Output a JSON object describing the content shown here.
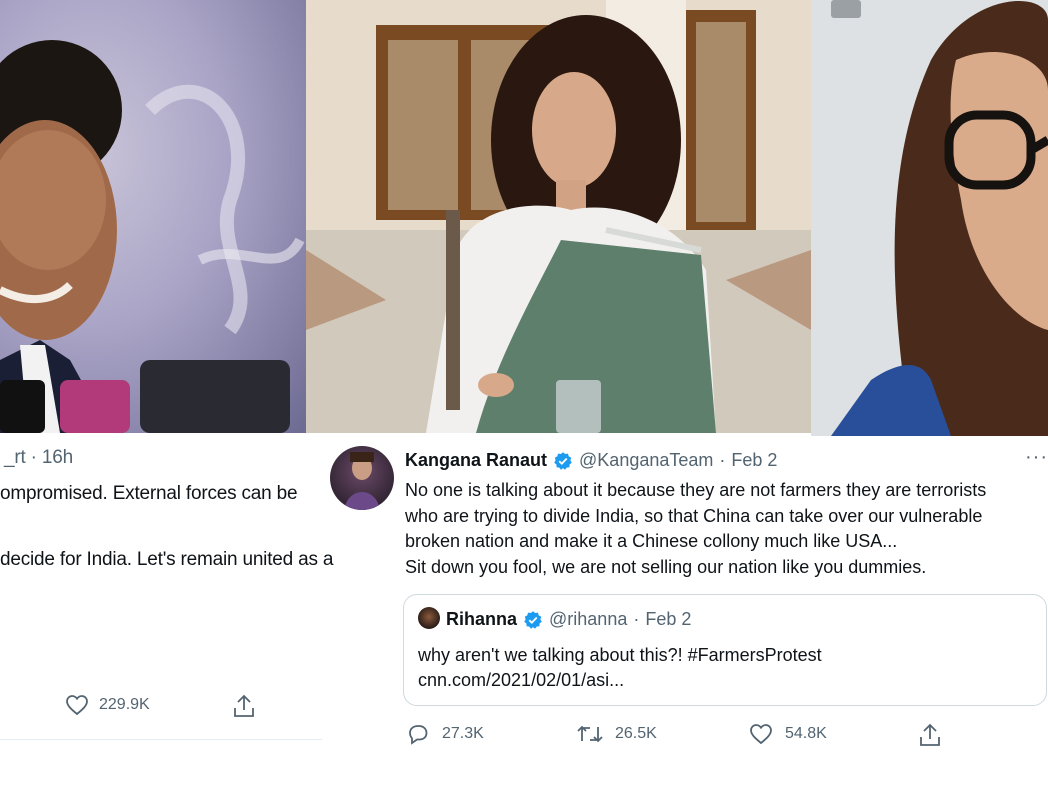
{
  "left_tweet": {
    "meta": "_rt · 16h",
    "text_line1": "ompromised. External forces can be",
    "text_line2": "decide for India. Let's remain united as a",
    "like_count": "229.9K"
  },
  "main_tweet": {
    "author_name": "Kangana Ranaut",
    "handle": "@KanganaTeam",
    "separator": "·",
    "date": "Feb 2",
    "more_label": "···",
    "body_lines": [
      "No one is talking about it because they are not farmers they are terrorists",
      "who are trying to divide India, so that China can take over our vulnerable",
      "broken nation and make it a Chinese collony much like USA...",
      "Sit down you fool, we are not selling our nation like you dummies."
    ],
    "quote": {
      "author_name": "Rihanna",
      "handle": "@rihanna",
      "separator": "·",
      "date": "Feb 2",
      "text": "why aren't we talking about this?! #FarmersProtest",
      "link": "cnn.com/2021/02/01/asi..."
    },
    "actions": {
      "reply_count": "27.3K",
      "retweet_count": "26.5K",
      "like_count": "54.8K"
    }
  },
  "colors": {
    "verified_blue": "#1d9bf0",
    "secondary_text": "#536471",
    "border": "#cfd9de"
  },
  "icons": [
    "verified-badge-icon",
    "reply-icon",
    "retweet-icon",
    "heart-icon",
    "share-icon",
    "more-icon"
  ]
}
